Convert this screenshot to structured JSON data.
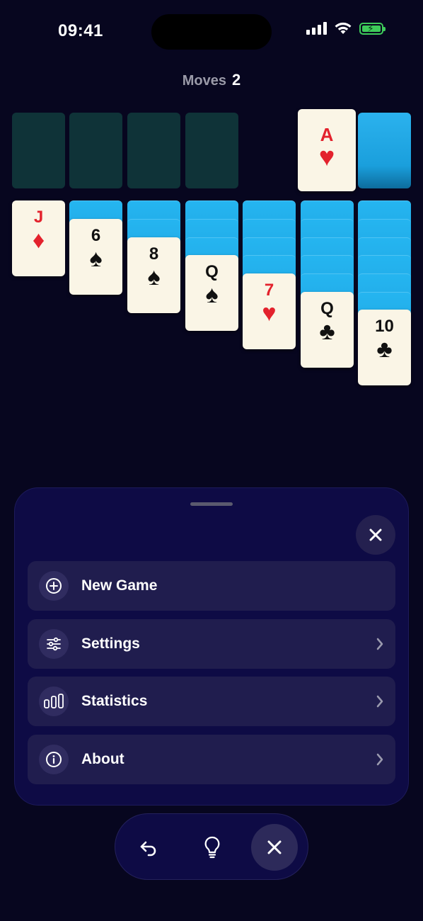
{
  "status": {
    "time": "09:41"
  },
  "moves": {
    "label": "Moves",
    "value": "2"
  },
  "foundation": {
    "ace": {
      "rank": "A",
      "suit": "♥"
    }
  },
  "tableau": [
    {
      "rank": "J",
      "suit": "♦"
    },
    {
      "rank": "6",
      "suit": "♠"
    },
    {
      "rank": "8",
      "suit": "♠"
    },
    {
      "rank": "Q",
      "suit": "♠"
    },
    {
      "rank": "7",
      "suit": "♥"
    },
    {
      "rank": "Q",
      "suit": "♣"
    },
    {
      "rank": "10",
      "suit": "♣"
    }
  ],
  "menu": {
    "items": [
      {
        "label": "New Game",
        "icon": "plus-circle-icon"
      },
      {
        "label": "Settings",
        "icon": "sliders-icon"
      },
      {
        "label": "Statistics",
        "icon": "bar-chart-icon"
      },
      {
        "label": "About",
        "icon": "info-icon"
      }
    ]
  },
  "toolbar": {
    "buttons": [
      "undo-icon",
      "hint-lightbulb-icon",
      "close-icon"
    ]
  },
  "colors": {
    "background": "#07061f",
    "sheet": "#0e0b45",
    "row": "#201d4e",
    "card_back": "#1fa6e6",
    "red_suit": "#e3222d"
  }
}
